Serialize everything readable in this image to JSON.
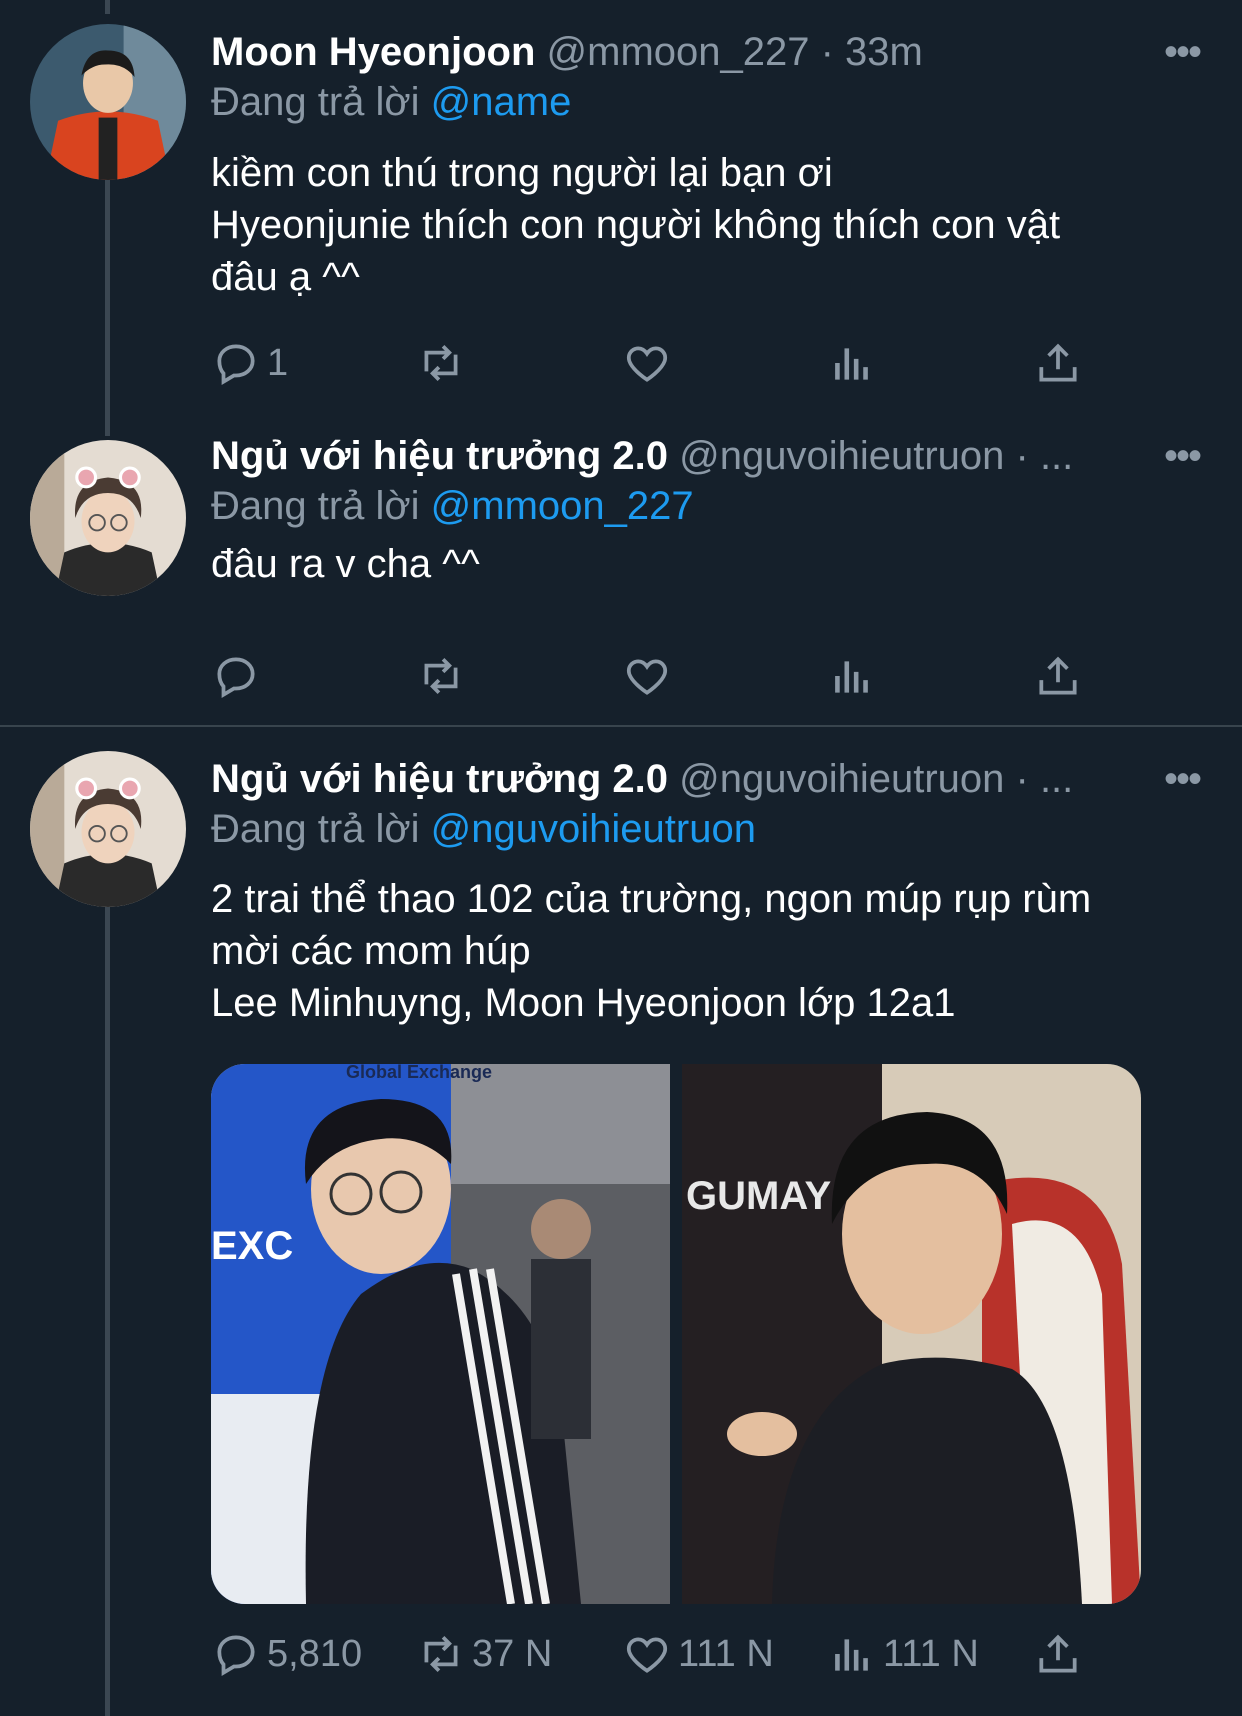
{
  "tweets": [
    {
      "name": "Moon Hyeonjoon",
      "handle": "@mmoon_227 · 33m",
      "replying_label": "Đang trả lời",
      "replying_to": "@name",
      "text_lines": [
        "kiềm con thú trong người lại bạn ơi",
        "Hyeonjunie thích con người không thích con vật",
        "đâu ạ ^^"
      ],
      "reply_count": "1",
      "retweet_count": "",
      "like_count": "",
      "view_count": ""
    },
    {
      "name": "Ngủ với hiệu trưởng 2.0",
      "handle": "@nguvoihieutruon · ...",
      "replying_label": "Đang trả lời",
      "replying_to": "@mmoon_227",
      "text_lines": [
        "đâu ra v cha ^^"
      ],
      "reply_count": "",
      "retweet_count": "",
      "like_count": "",
      "view_count": ""
    },
    {
      "name": "Ngủ với hiệu trưởng 2.0",
      "handle": "@nguvoihieutruon · ...",
      "replying_label": "Đang trả lời",
      "replying_to": "@nguvoihieutruon",
      "text_lines": [
        "2 trai thể thao 102 của trường, ngon múp rụp rùm",
        "mời các mom húp",
        "Lee Minhuyng, Moon Hyeonjoon lớp 12a1"
      ],
      "reply_count": "5,810",
      "retweet_count": "37 N",
      "like_count": "111 N",
      "view_count": "111 N"
    }
  ],
  "more_label": "•••",
  "photo_texts": {
    "left_sign_top": "Global Exchange",
    "left_sign_mid": "EXC",
    "right_jersey": "GUMAY"
  },
  "colors": {
    "background": "#15202b",
    "secondary_text": "#8b98a5",
    "accent": "#1d9bf0"
  }
}
